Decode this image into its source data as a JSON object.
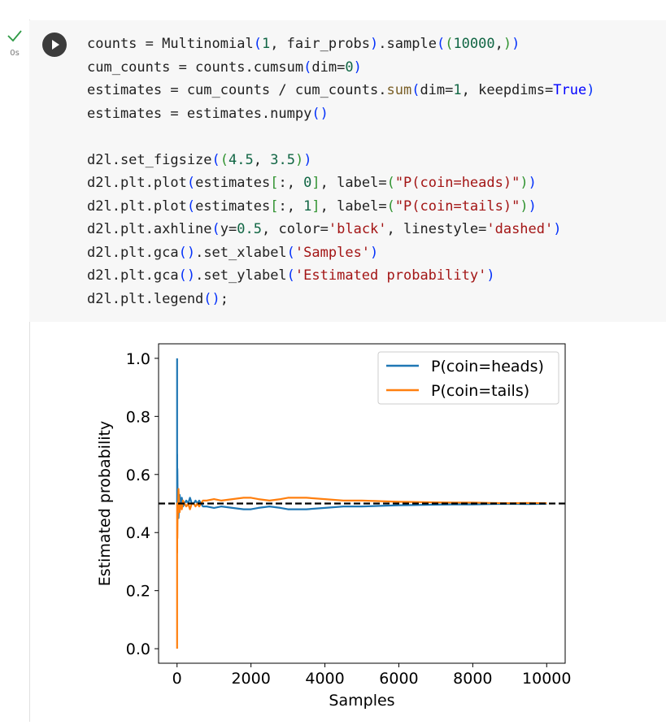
{
  "cell": {
    "status_time": "0s",
    "status_icon": "check-icon",
    "run_icon": "play-icon",
    "code_lines": [
      [
        {
          "t": "counts = Multinomial"
        },
        {
          "t": "(",
          "c": "kw-br1"
        },
        {
          "t": "1",
          "c": "kw-num"
        },
        {
          "t": ", fair_probs"
        },
        {
          "t": ")",
          "c": "kw-br1"
        },
        {
          "t": ".sample"
        },
        {
          "t": "(",
          "c": "kw-br1"
        },
        {
          "t": "(",
          "c": "kw-br2"
        },
        {
          "t": "10000",
          "c": "kw-num"
        },
        {
          "t": ",",
          "c": ""
        },
        {
          "t": ")",
          "c": "kw-br2"
        },
        {
          "t": ")",
          "c": "kw-br1"
        }
      ],
      [
        {
          "t": "cum_counts = counts.cumsum"
        },
        {
          "t": "(",
          "c": "kw-br1"
        },
        {
          "t": "dim="
        },
        {
          "t": "0",
          "c": "kw-num"
        },
        {
          "t": ")",
          "c": "kw-br1"
        }
      ],
      [
        {
          "t": "estimates = cum_counts / cum_counts."
        },
        {
          "t": "sum",
          "c": "kw-fn"
        },
        {
          "t": "(",
          "c": "kw-br1"
        },
        {
          "t": "dim="
        },
        {
          "t": "1",
          "c": "kw-num"
        },
        {
          "t": ", keepdims="
        },
        {
          "t": "True",
          "c": "kw-true"
        },
        {
          "t": ")",
          "c": "kw-br1"
        }
      ],
      [
        {
          "t": "estimates = estimates.numpy"
        },
        {
          "t": "()",
          "c": "kw-br1"
        }
      ],
      [
        {
          "t": ""
        }
      ],
      [
        {
          "t": "d2l.set_figsize"
        },
        {
          "t": "(",
          "c": "kw-br1"
        },
        {
          "t": "(",
          "c": "kw-br2"
        },
        {
          "t": "4.5",
          "c": "kw-num"
        },
        {
          "t": ", "
        },
        {
          "t": "3.5",
          "c": "kw-num"
        },
        {
          "t": ")",
          "c": "kw-br2"
        },
        {
          "t": ")",
          "c": "kw-br1"
        }
      ],
      [
        {
          "t": "d2l.plt.plot"
        },
        {
          "t": "(",
          "c": "kw-br1"
        },
        {
          "t": "estimates"
        },
        {
          "t": "[",
          "c": "kw-br2"
        },
        {
          "t": ":, "
        },
        {
          "t": "0",
          "c": "kw-num"
        },
        {
          "t": "]",
          "c": "kw-br2"
        },
        {
          "t": ", label="
        },
        {
          "t": "(",
          "c": "kw-br2"
        },
        {
          "t": "\"P(coin=heads)\"",
          "c": "kw-str"
        },
        {
          "t": ")",
          "c": "kw-br2"
        },
        {
          "t": ")",
          "c": "kw-br1"
        }
      ],
      [
        {
          "t": "d2l.plt.plot"
        },
        {
          "t": "(",
          "c": "kw-br1"
        },
        {
          "t": "estimates"
        },
        {
          "t": "[",
          "c": "kw-br2"
        },
        {
          "t": ":, "
        },
        {
          "t": "1",
          "c": "kw-num"
        },
        {
          "t": "]",
          "c": "kw-br2"
        },
        {
          "t": ", label="
        },
        {
          "t": "(",
          "c": "kw-br2"
        },
        {
          "t": "\"P(coin=tails)\"",
          "c": "kw-str"
        },
        {
          "t": ")",
          "c": "kw-br2"
        },
        {
          "t": ")",
          "c": "kw-br1"
        }
      ],
      [
        {
          "t": "d2l.plt.axhline"
        },
        {
          "t": "(",
          "c": "kw-br1"
        },
        {
          "t": "y="
        },
        {
          "t": "0.5",
          "c": "kw-num"
        },
        {
          "t": ", color="
        },
        {
          "t": "'black'",
          "c": "kw-str"
        },
        {
          "t": ", linestyle="
        },
        {
          "t": "'dashed'",
          "c": "kw-str"
        },
        {
          "t": ")",
          "c": "kw-br1"
        }
      ],
      [
        {
          "t": "d2l.plt.gca"
        },
        {
          "t": "()",
          "c": "kw-br1"
        },
        {
          "t": ".set_xlabel"
        },
        {
          "t": "(",
          "c": "kw-br1"
        },
        {
          "t": "'Samples'",
          "c": "kw-str"
        },
        {
          "t": ")",
          "c": "kw-br1"
        }
      ],
      [
        {
          "t": "d2l.plt.gca"
        },
        {
          "t": "()",
          "c": "kw-br1"
        },
        {
          "t": ".set_ylabel"
        },
        {
          "t": "(",
          "c": "kw-br1"
        },
        {
          "t": "'Estimated probability'",
          "c": "kw-str"
        },
        {
          "t": ")",
          "c": "kw-br1"
        }
      ],
      [
        {
          "t": "d2l.plt.legend"
        },
        {
          "t": "()",
          "c": "kw-br1"
        },
        {
          "t": ";"
        }
      ]
    ]
  },
  "chart_data": {
    "type": "line",
    "xlabel": "Samples",
    "ylabel": "Estimated probability",
    "xlim": [
      -500,
      10500
    ],
    "ylim": [
      -0.05,
      1.05
    ],
    "xticks": [
      0,
      2000,
      4000,
      6000,
      8000,
      10000
    ],
    "yticks": [
      0.0,
      0.2,
      0.4,
      0.6,
      0.8,
      1.0
    ],
    "xtick_labels": [
      "0",
      "2000",
      "4000",
      "6000",
      "8000",
      "10000"
    ],
    "ytick_labels": [
      "0.0",
      "0.2",
      "0.4",
      "0.6",
      "0.8",
      "1.0"
    ],
    "legend_position": "top-right",
    "grid": false,
    "hline": {
      "y": 0.5,
      "color": "#000000",
      "style": "dashed"
    },
    "series": [
      {
        "name": "P(coin=heads)",
        "color": "#1f77b4",
        "x": [
          1,
          2,
          3,
          4,
          6,
          8,
          10,
          15,
          20,
          30,
          40,
          50,
          70,
          100,
          130,
          160,
          200,
          250,
          300,
          350,
          400,
          450,
          500,
          550,
          600,
          700,
          800,
          1000,
          1200,
          1500,
          1800,
          2000,
          2200,
          2500,
          2800,
          3000,
          3500,
          4000,
          4500,
          5000,
          5500,
          6000,
          6500,
          7000,
          7500,
          8000,
          8500,
          9000,
          9500,
          10000
        ],
        "y": [
          1.0,
          0.5,
          0.67,
          0.5,
          0.5,
          0.62,
          0.6,
          0.53,
          0.55,
          0.5,
          0.45,
          0.48,
          0.53,
          0.5,
          0.52,
          0.49,
          0.5,
          0.51,
          0.5,
          0.52,
          0.5,
          0.5,
          0.51,
          0.5,
          0.51,
          0.49,
          0.49,
          0.485,
          0.49,
          0.485,
          0.48,
          0.48,
          0.485,
          0.49,
          0.485,
          0.48,
          0.48,
          0.485,
          0.49,
          0.49,
          0.492,
          0.494,
          0.495,
          0.496,
          0.497,
          0.497,
          0.498,
          0.499,
          0.498,
          0.499
        ]
      },
      {
        "name": "P(coin=tails)",
        "color": "#ff7f0e",
        "x": [
          1,
          2,
          3,
          4,
          6,
          8,
          10,
          15,
          20,
          30,
          40,
          50,
          70,
          100,
          130,
          160,
          200,
          250,
          300,
          350,
          400,
          450,
          500,
          550,
          600,
          700,
          800,
          1000,
          1200,
          1500,
          1800,
          2000,
          2200,
          2500,
          2800,
          3000,
          3500,
          4000,
          4500,
          5000,
          5500,
          6000,
          6500,
          7000,
          7500,
          8000,
          8500,
          9000,
          9500,
          10000
        ],
        "y": [
          0.0,
          0.5,
          0.33,
          0.5,
          0.5,
          0.38,
          0.4,
          0.47,
          0.45,
          0.5,
          0.55,
          0.52,
          0.47,
          0.5,
          0.48,
          0.51,
          0.5,
          0.49,
          0.5,
          0.48,
          0.5,
          0.5,
          0.49,
          0.5,
          0.49,
          0.51,
          0.51,
          0.515,
          0.51,
          0.515,
          0.52,
          0.52,
          0.515,
          0.51,
          0.515,
          0.52,
          0.52,
          0.515,
          0.51,
          0.51,
          0.508,
          0.506,
          0.505,
          0.504,
          0.503,
          0.503,
          0.502,
          0.501,
          0.502,
          0.501
        ]
      }
    ]
  }
}
